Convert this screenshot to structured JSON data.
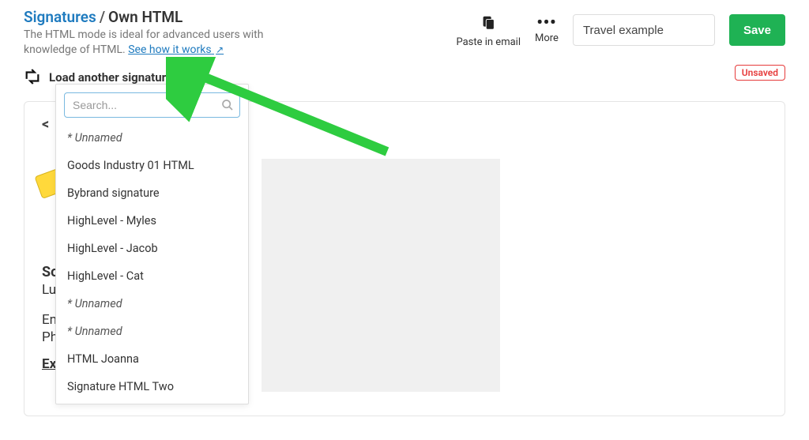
{
  "breadcrumb": {
    "root": "Signatures",
    "current": "Own HTML"
  },
  "subheading": {
    "text": "The HTML mode is ideal for advanced users with knowledge of HTML.",
    "link_text": "See how it works"
  },
  "top_actions": {
    "paste_label": "Paste in email",
    "more_label": "More"
  },
  "name_input_value": "Travel example",
  "save_label": "Save",
  "load_label": "Load another signature",
  "unsaved_label": "Unsaved",
  "dropdown": {
    "search_placeholder": "Search...",
    "items": [
      {
        "label": "* Unnamed",
        "italic": true
      },
      {
        "label": "Goods Industry 01 HTML",
        "italic": false
      },
      {
        "label": "Bybrand signature",
        "italic": false
      },
      {
        "label": "HighLevel - Myles",
        "italic": false
      },
      {
        "label": "HighLevel - Jacob",
        "italic": false
      },
      {
        "label": "HighLevel - Cat",
        "italic": false
      },
      {
        "label": "* Unnamed",
        "italic": true
      },
      {
        "label": "* Unnamed",
        "italic": true
      },
      {
        "label": "HTML Joanna",
        "italic": false
      },
      {
        "label": "Signature HTML Two",
        "italic": false
      }
    ]
  },
  "preview_partial": {
    "t1": "So",
    "t2": "Lu",
    "t3": "En",
    "t4": "Ph",
    "t5": "Ex"
  },
  "colors": {
    "accent_green": "#1fb254",
    "link_blue": "#1f7bbf",
    "danger_red": "#e63b3b",
    "ribbon_yellow": "#ffd93b",
    "arrow_green": "#2ecc40"
  }
}
